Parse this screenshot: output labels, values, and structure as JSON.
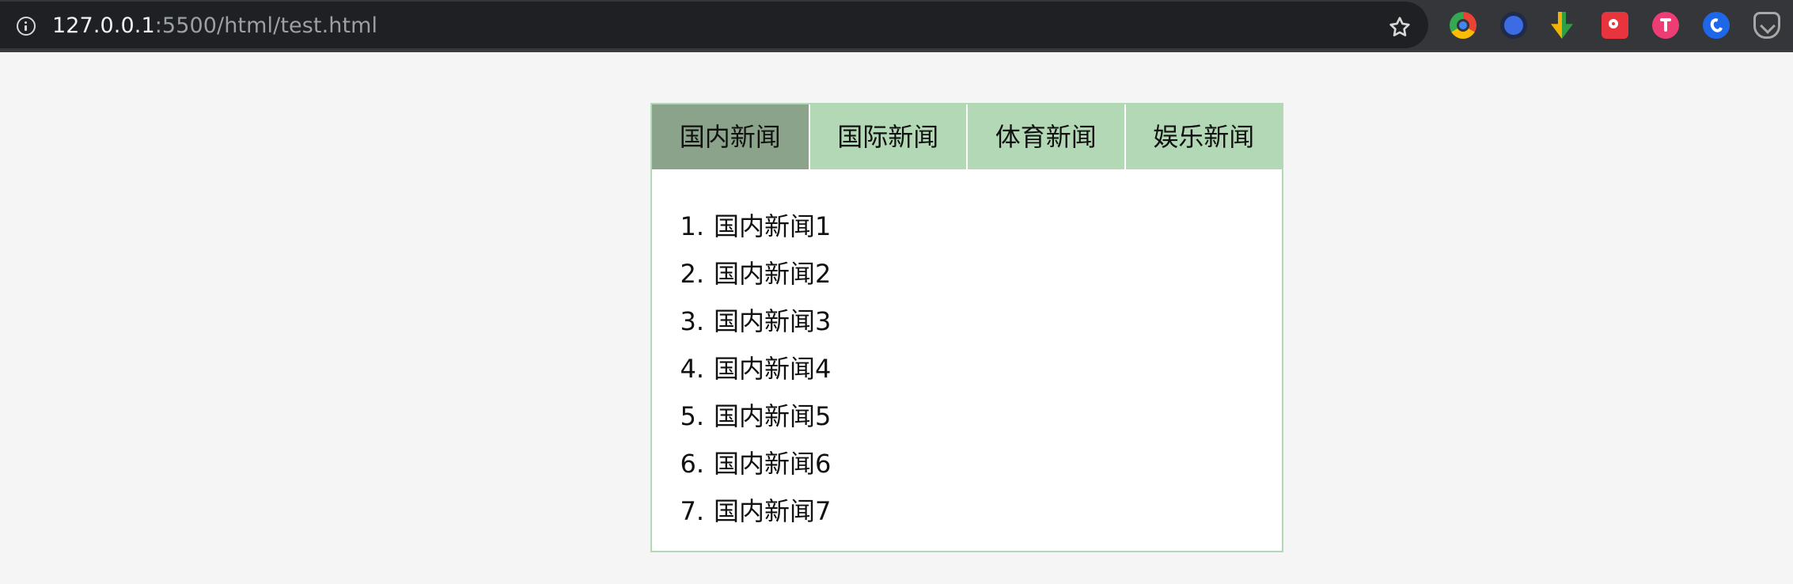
{
  "browser": {
    "url_host": "127.0.0.1",
    "url_path": ":5500/html/test.html",
    "extension_icons": [
      "chrome-extension-icon",
      "blue-dot-extension-icon",
      "downloader-extension-icon",
      "red-gear-extension-icon",
      "pink-t-extension-icon",
      "blue-swirl-extension-icon",
      "pocket-extension-icon"
    ]
  },
  "tabs": [
    {
      "label": "国内新闻",
      "active": true
    },
    {
      "label": "国际新闻",
      "active": false
    },
    {
      "label": "体育新闻",
      "active": false
    },
    {
      "label": "娱乐新闻",
      "active": false
    }
  ],
  "news": {
    "items": [
      {
        "index": "1.",
        "title": "国内新闻1"
      },
      {
        "index": "2.",
        "title": "国内新闻2"
      },
      {
        "index": "3.",
        "title": "国内新闻3"
      },
      {
        "index": "4.",
        "title": "国内新闻4"
      },
      {
        "index": "5.",
        "title": "国内新闻5"
      },
      {
        "index": "6.",
        "title": "国内新闻6"
      },
      {
        "index": "7.",
        "title": "国内新闻7"
      }
    ]
  },
  "colors": {
    "page_background": "#f5f5f5",
    "tab_background": "#b3d8b5",
    "active_tab_background": "#8aa38a",
    "panel_border": "#b3d8b5"
  }
}
